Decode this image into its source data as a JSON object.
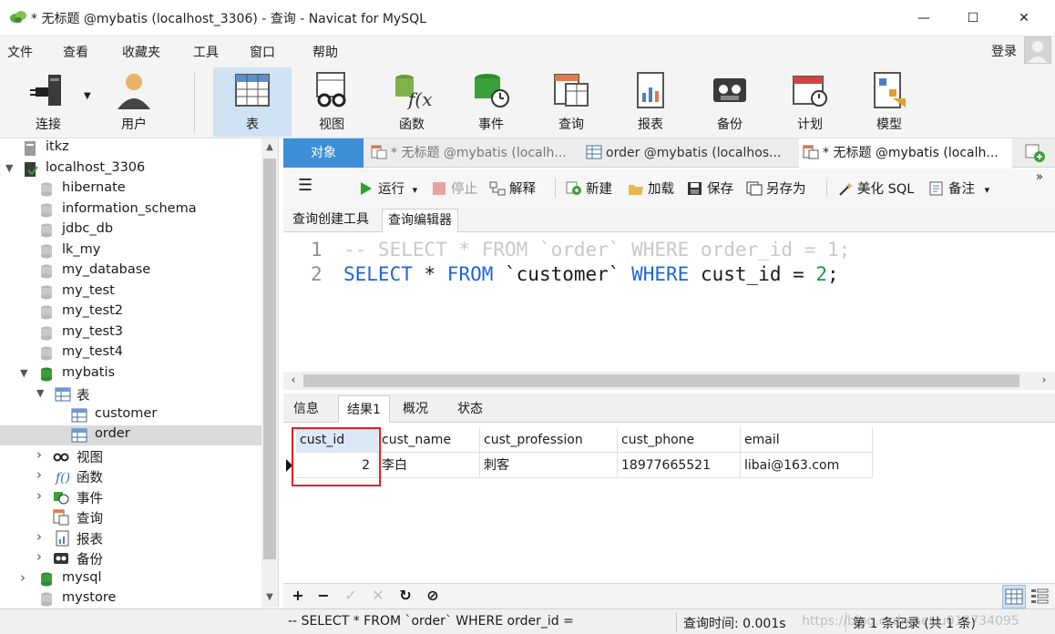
{
  "window": {
    "title": "* 无标题 @mybatis (localhost_3306) - 查询 - Navicat for MySQL",
    "minimize_glyph": "—",
    "maximize_glyph": "☐",
    "close_glyph": "✕"
  },
  "menu": {
    "items": [
      "文件",
      "查看",
      "收藏夹",
      "工具",
      "窗口",
      "帮助"
    ],
    "login": "登录"
  },
  "toolbar": {
    "items": [
      {
        "label": "连接",
        "icon": "connection-plug-icon"
      },
      {
        "label": "用户",
        "icon": "user-icon"
      },
      {
        "label": "表",
        "icon": "table-icon"
      },
      {
        "label": "视图",
        "icon": "view-glasses-icon"
      },
      {
        "label": "函数",
        "icon": "function-icon"
      },
      {
        "label": "事件",
        "icon": "event-clock-icon"
      },
      {
        "label": "查询",
        "icon": "query-icon"
      },
      {
        "label": "报表",
        "icon": "report-icon"
      },
      {
        "label": "备份",
        "icon": "backup-tape-icon"
      },
      {
        "label": "计划",
        "icon": "schedule-calendar-icon"
      },
      {
        "label": "模型",
        "icon": "model-icon"
      }
    ],
    "active": "表"
  },
  "tree": {
    "rows": [
      {
        "label": "itkz",
        "icon": "server-icon",
        "expander": ""
      },
      {
        "label": "localhost_3306",
        "icon": "server-connected-icon",
        "expander": "▼"
      },
      {
        "label": "hibernate",
        "icon": "database-icon",
        "expander": ""
      },
      {
        "label": "information_schema",
        "icon": "database-icon",
        "expander": ""
      },
      {
        "label": "jdbc_db",
        "icon": "database-icon",
        "expander": ""
      },
      {
        "label": "lk_my",
        "icon": "database-icon",
        "expander": ""
      },
      {
        "label": "my_database",
        "icon": "database-icon",
        "expander": ""
      },
      {
        "label": "my_test",
        "icon": "database-icon",
        "expander": ""
      },
      {
        "label": "my_test2",
        "icon": "database-icon",
        "expander": ""
      },
      {
        "label": "my_test3",
        "icon": "database-icon",
        "expander": ""
      },
      {
        "label": "my_test4",
        "icon": "database-icon",
        "expander": ""
      },
      {
        "label": "mybatis",
        "icon": "database-open-icon",
        "expander": "▼"
      },
      {
        "label": "表",
        "icon": "table-icon",
        "expander": "▼"
      },
      {
        "label": "customer",
        "icon": "table-icon",
        "expander": ""
      },
      {
        "label": "order",
        "icon": "table-icon",
        "expander": ""
      },
      {
        "label": "视图",
        "icon": "view-glasses-icon",
        "expander": "›"
      },
      {
        "label": "函数",
        "icon": "function-icon",
        "expander": "›"
      },
      {
        "label": "事件",
        "icon": "event-clock-icon",
        "expander": "›"
      },
      {
        "label": "查询",
        "icon": "query-icon",
        "expander": ""
      },
      {
        "label": "报表",
        "icon": "report-icon",
        "expander": "›"
      },
      {
        "label": "备份",
        "icon": "backup-tape-icon",
        "expander": "›"
      },
      {
        "label": "mysql",
        "icon": "database-open-icon",
        "expander": "›"
      },
      {
        "label": "mystore",
        "icon": "database-icon",
        "expander": ""
      }
    ],
    "selected": "order"
  },
  "tabs": {
    "object": "对象",
    "items": [
      {
        "label": "* 无标题 @mybatis (localh...",
        "icon": "query-icon"
      },
      {
        "label": "order @mybatis (localhos...",
        "icon": "table-icon"
      },
      {
        "label": "* 无标题 @mybatis (localh...",
        "icon": "query-icon"
      }
    ],
    "add_icon": "new-tab-icon"
  },
  "query_toolbar": {
    "menu_glyph": "☰",
    "run": "运行",
    "stop": "停止",
    "explain": "解释",
    "new": "新建",
    "load": "加载",
    "save": "保存",
    "save_as": "另存为",
    "beautify": "美化 SQL",
    "note": "备注",
    "dropdown_glyph": "▾",
    "overflow_glyph": "»"
  },
  "editor_tabs": {
    "builder": "查询创建工具",
    "editor": "查询编辑器"
  },
  "code": {
    "line1_no": "1",
    "line1": "-- SELECT * FROM `order` WHERE order_id = 1;",
    "line2_no": "2",
    "line2_kw1": "SELECT",
    "line2_a": " * ",
    "line2_kw2": "FROM",
    "line2_b": " `customer` ",
    "line2_kw3": "WHERE",
    "line2_c": " cust_id = ",
    "line2_num": "2",
    "line2_end": ";"
  },
  "result_tabs": [
    "信息",
    "结果1",
    "概况",
    "状态"
  ],
  "result": {
    "columns": [
      "cust_id",
      "cust_name",
      "cust_profession",
      "cust_phone",
      "email"
    ],
    "rows": [
      [
        "2",
        "李白",
        "刺客",
        "18977665521",
        "libai@163.com"
      ]
    ]
  },
  "grid_toolbar": {
    "add": "+",
    "remove": "−",
    "apply": "✓",
    "discard": "✕",
    "refresh": "↻",
    "stop": "⊘"
  },
  "status": {
    "sql": "-- SELECT * FROM `order` WHERE order_id =",
    "query_time": "查询时间: 0.001s",
    "records": "第 1 条记录 (共 1 条)",
    "watermark": "https://blog.csdn.net/u013734095"
  },
  "colors": {
    "accent": "#3d8fd8",
    "active_tool": "#cfe2f3",
    "keyword": "#1e64dc",
    "comment": "#c8c8c8",
    "number": "#169c3c",
    "highlight_box": "#e02020"
  }
}
